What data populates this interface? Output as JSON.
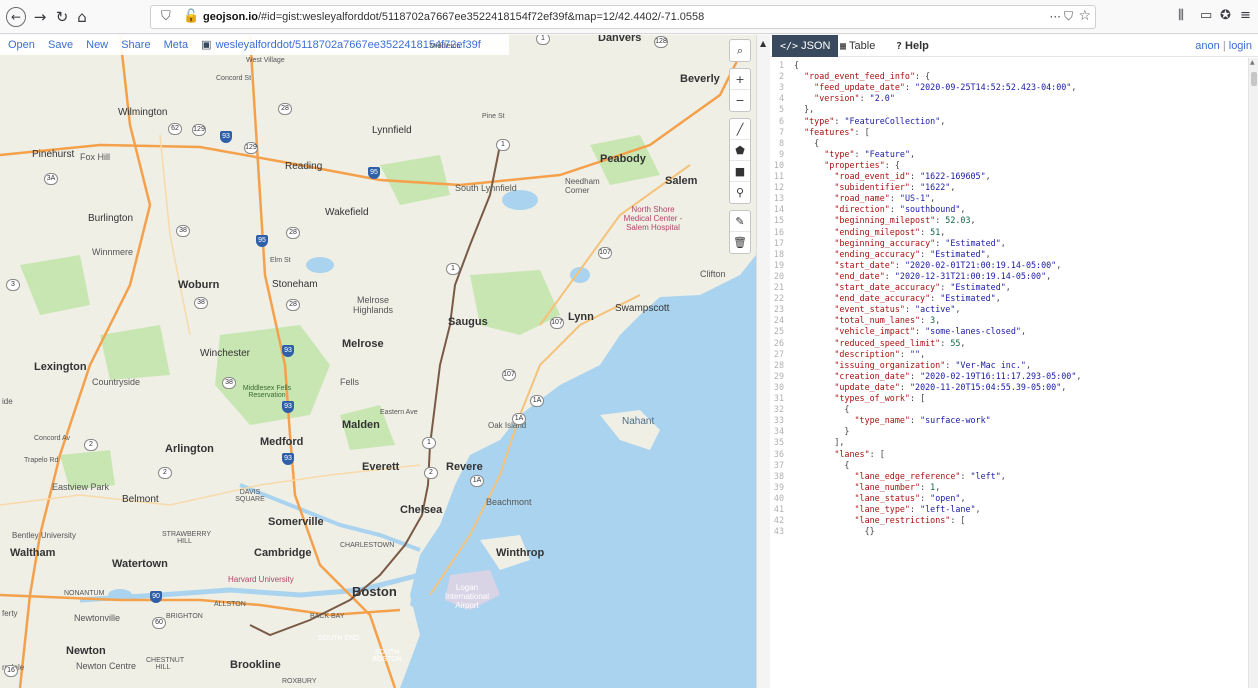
{
  "browser": {
    "url_domain": "geojson.io",
    "url_path": "/#id=gist:wesleyalforddot/5118702a7667ee3522418154f72ef39f&map=12/42.4402/-71.0558",
    "icons": [
      "back-icon",
      "forward-icon",
      "reload-icon",
      "home-icon",
      "shield-icon",
      "insecure-lock-icon",
      "page-actions-icon",
      "pocket-icon",
      "bookmark-star-icon",
      "library-icon",
      "sidebar-icon",
      "extension-icon",
      "menu-icon"
    ]
  },
  "map_menu": {
    "open": "Open",
    "save": "Save",
    "new": "New",
    "share": "Share",
    "meta": "Meta",
    "gist_label": "wesleyalforddot/5118702a7667ee3522418154f72ef39f"
  },
  "map_controls": {
    "search": "⌕",
    "zoom_in": "+",
    "zoom_out": "−",
    "draw_line": "╱",
    "draw_polygon": "⬟",
    "draw_rectangle": "■",
    "draw_marker": "⚲",
    "edit": "✎",
    "delete": "🗑"
  },
  "map_labels": {
    "places": [
      {
        "id": "danvers",
        "text": "Danvers"
      },
      {
        "id": "beverly",
        "text": "Beverly"
      },
      {
        "id": "wilmington",
        "text": "Wilmington"
      },
      {
        "id": "lynnfield",
        "text": "Lynnfield"
      },
      {
        "id": "peabody",
        "text": "Peabody"
      },
      {
        "id": "salem",
        "text": "Salem"
      },
      {
        "id": "pinehurst",
        "text": "Pinehurst"
      },
      {
        "id": "foxhill",
        "text": "Fox Hill"
      },
      {
        "id": "reading",
        "text": "Reading"
      },
      {
        "id": "southlynnfield",
        "text": "South Lynnfield"
      },
      {
        "id": "needham",
        "text": "Needham Corner"
      },
      {
        "id": "burlington",
        "text": "Burlington"
      },
      {
        "id": "wakefield",
        "text": "Wakefield"
      },
      {
        "id": "winnmere",
        "text": "Winnmere"
      },
      {
        "id": "clifton",
        "text": "Clifton"
      },
      {
        "id": "woburn",
        "text": "Woburn"
      },
      {
        "id": "stoneham",
        "text": "Stoneham"
      },
      {
        "id": "melrosehighlands",
        "text": "Melrose Highlands"
      },
      {
        "id": "saugus",
        "text": "Saugus"
      },
      {
        "id": "lynn",
        "text": "Lynn"
      },
      {
        "id": "swampscott",
        "text": "Swampscott"
      },
      {
        "id": "winchester",
        "text": "Winchester"
      },
      {
        "id": "melrose",
        "text": "Melrose"
      },
      {
        "id": "lexington",
        "text": "Lexington"
      },
      {
        "id": "countryside",
        "text": "Countryside"
      },
      {
        "id": "fells",
        "text": "Fells"
      },
      {
        "id": "malden",
        "text": "Malden"
      },
      {
        "id": "nahant",
        "text": "Nahant"
      },
      {
        "id": "arlington",
        "text": "Arlington"
      },
      {
        "id": "medford",
        "text": "Medford"
      },
      {
        "id": "everett",
        "text": "Everett"
      },
      {
        "id": "revere",
        "text": "Revere"
      },
      {
        "id": "eastviewpark",
        "text": "Eastview Park"
      },
      {
        "id": "belmont",
        "text": "Belmont"
      },
      {
        "id": "davissquare",
        "text": "DAVIS SQUARE"
      },
      {
        "id": "chelsea",
        "text": "Chelsea"
      },
      {
        "id": "beachmont",
        "text": "Beachmont"
      },
      {
        "id": "somerville",
        "text": "Somerville"
      },
      {
        "id": "bentley",
        "text": "Bentley University"
      },
      {
        "id": "strawberryhill",
        "text": "STRAWBERRY HILL"
      },
      {
        "id": "charlestown",
        "text": "CHARLESTOWN"
      },
      {
        "id": "winthrop",
        "text": "Winthrop"
      },
      {
        "id": "waltham",
        "text": "Waltham"
      },
      {
        "id": "watertown",
        "text": "Watertown"
      },
      {
        "id": "cambridge",
        "text": "Cambridge"
      },
      {
        "id": "harvard",
        "text": "Harvard University"
      },
      {
        "id": "nonantum",
        "text": "NONANTUM"
      },
      {
        "id": "allston",
        "text": "ALLSTON"
      },
      {
        "id": "boston",
        "text": "Boston"
      },
      {
        "id": "logan",
        "text": "Logan International Airport"
      },
      {
        "id": "newtonville",
        "text": "Newtonville"
      },
      {
        "id": "brighton",
        "text": "BRIGHTON"
      },
      {
        "id": "backbay",
        "text": "BACK BAY"
      },
      {
        "id": "southend",
        "text": "SOUTH END"
      },
      {
        "id": "southboston",
        "text": "SOUTH BOSTON"
      },
      {
        "id": "newton",
        "text": "Newton"
      },
      {
        "id": "newtoncentre",
        "text": "Newton Centre"
      },
      {
        "id": "chestnuthill",
        "text": "CHESTNUT HILL"
      },
      {
        "id": "brookline",
        "text": "Brookline"
      },
      {
        "id": "roxbury",
        "text": "ROXBURY"
      },
      {
        "id": "middlesexfells",
        "text": "Middlesex Fells Reservation"
      },
      {
        "id": "northshore",
        "text": "North Shore Medical Center - Salem Hospital"
      },
      {
        "id": "oakisland",
        "text": "Oak Island"
      },
      {
        "id": "concordav",
        "text": "Concord Av"
      },
      {
        "id": "trapelord",
        "text": "Trapelo Rd"
      },
      {
        "id": "pinest",
        "text": "Pine St"
      },
      {
        "id": "elmst",
        "text": "Elm St"
      },
      {
        "id": "easternave",
        "text": "Eastern Ave"
      },
      {
        "id": "westvillage",
        "text": "West Village"
      },
      {
        "id": "concordst",
        "text": "Concord St"
      },
      {
        "id": "middleton",
        "text": "Middleton"
      },
      {
        "id": "rurdale",
        "text": "rndale"
      },
      {
        "id": "ide",
        "text": "ide"
      },
      {
        "id": "ftcy",
        "text": "ferty"
      }
    ],
    "shields": [
      "128",
      "1",
      "129",
      "93",
      "28",
      "3A",
      "62",
      "38",
      "107",
      "2",
      "1A",
      "16",
      "60",
      "90",
      "95",
      "3"
    ]
  },
  "panel": {
    "tabs": [
      {
        "id": "json",
        "icon": "</>",
        "label": "JSON"
      },
      {
        "id": "table",
        "icon": "▦",
        "label": "Table"
      },
      {
        "id": "help",
        "icon": "?",
        "label": "Help"
      }
    ],
    "auth": {
      "anon": "anon",
      "sep": "|",
      "login": "login"
    }
  },
  "json_lines": [
    "{",
    "  \"road_event_feed_info\": {",
    "    \"feed_update_date\": \"2020-09-25T14:52:52.423-04:00\",",
    "    \"version\": \"2.0\"",
    "  },",
    "  \"type\": \"FeatureCollection\",",
    "  \"features\": [",
    "    {",
    "      \"type\": \"Feature\",",
    "      \"properties\": {",
    "        \"road_event_id\": \"1622-169605\",",
    "        \"subidentifier\": \"1622\",",
    "        \"road_name\": \"US-1\",",
    "        \"direction\": \"southbound\",",
    "        \"beginning_milepost\": 52.03,",
    "        \"ending_milepost\": 51,",
    "        \"beginning_accuracy\": \"Estimated\",",
    "        \"ending_accuracy\": \"Estimated\",",
    "        \"start_date\": \"2020-02-01T21:00:19.14-05:00\",",
    "        \"end_date\": \"2020-12-31T21:00:19.14-05:00\",",
    "        \"start_date_accuracy\": \"Estimated\",",
    "        \"end_date_accuracy\": \"Estimated\",",
    "        \"event_status\": \"active\",",
    "        \"total_num_lanes\": 3,",
    "        \"vehicle_impact\": \"some-lanes-closed\",",
    "        \"reduced_speed_limit\": 55,",
    "        \"description\": \"\",",
    "        \"issuing_organization\": \"Ver-Mac inc.\",",
    "        \"creation_date\": \"2020-02-19T16:11:17.293-05:00\",",
    "        \"update_date\": \"2020-11-20T15:04:55.39-05:00\",",
    "        \"types_of_work\": [",
    "          {",
    "            \"type_name\": \"surface-work\"",
    "          }",
    "        ],",
    "        \"lanes\": [",
    "          {",
    "            \"lane_edge_reference\": \"left\",",
    "            \"lane_number\": 1,",
    "            \"lane_status\": \"open\",",
    "            \"lane_type\": \"left-lane\",",
    "            \"lane_restrictions\": [",
    "              {}"
  ],
  "colors": {
    "land": "#efefe6",
    "water": "#a9d3ee",
    "park": "#c8e6b2",
    "highway": "#f5a04a",
    "route_line": "#7a5a45",
    "tab_active": "#3a4a5e",
    "link": "#3b6fd4"
  }
}
